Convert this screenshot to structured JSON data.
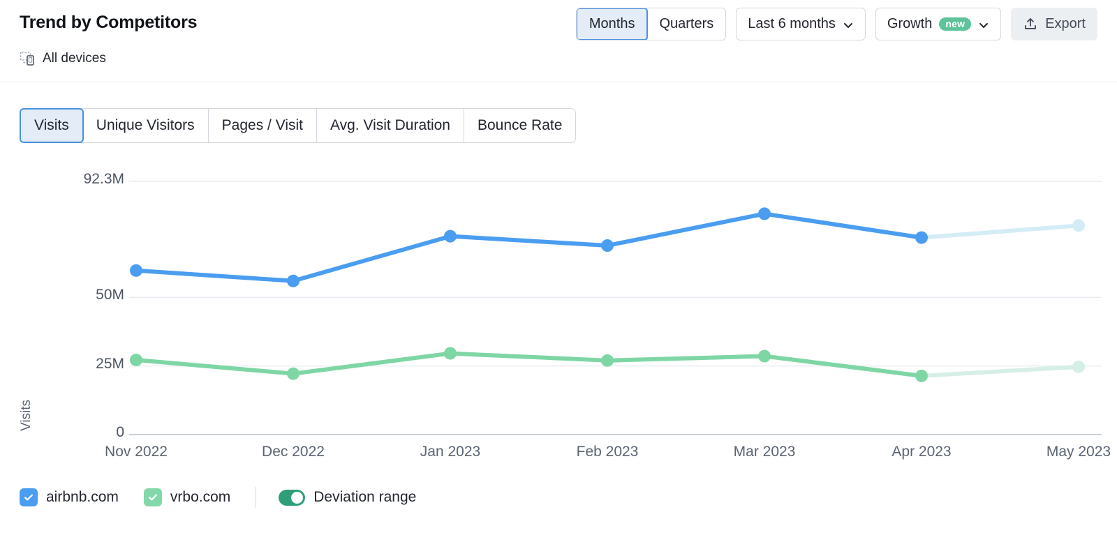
{
  "header": {
    "title": "Trend by Competitors",
    "devices_label": "All devices",
    "devices_icon": "devices-icon",
    "granularity": {
      "options": [
        "Months",
        "Quarters"
      ],
      "selected": "Months"
    },
    "period": {
      "label": "Last 6 months",
      "icon": "chevron-down-icon"
    },
    "growth": {
      "label": "Growth",
      "badge": "new",
      "icon": "chevron-down-icon"
    },
    "export": {
      "label": "Export",
      "icon": "upload-icon"
    }
  },
  "tabs": {
    "items": [
      "Visits",
      "Unique Visitors",
      "Pages / Visit",
      "Avg. Visit Duration",
      "Bounce Rate"
    ],
    "selected": "Visits"
  },
  "legend": {
    "items": [
      {
        "label": "airbnb.com",
        "color": "#4a9df0",
        "checked": true
      },
      {
        "label": "vrbo.com",
        "color": "#82d8a8",
        "checked": true
      }
    ],
    "deviation": {
      "label": "Deviation range",
      "enabled": true,
      "color": "#2e9e78"
    }
  },
  "colors": {
    "airbnb": "#4a9df0",
    "vrbo": "#7fd6a5",
    "airbnb_faded": "#d3ecf5",
    "vrbo_faded": "#d6efe6",
    "grid": "#e8ecf1",
    "axis": "#b9c0c9",
    "accent": "#4a90e2",
    "badge_green": "#5ec39a",
    "toggle_green": "#2e9e78"
  },
  "chart_data": {
    "type": "line",
    "title": "Trend by Competitors",
    "ylabel": "Visits",
    "xlabel": "",
    "categories": [
      "Nov 2022",
      "Dec 2022",
      "Jan 2023",
      "Feb 2023",
      "Mar 2023",
      "Apr 2023",
      "May 2023"
    ],
    "yticks": [
      "0",
      "25M",
      "50M",
      "92.3M"
    ],
    "ytick_values": [
      0,
      25000000,
      50000000,
      92300000
    ],
    "ylim": [
      0,
      92300000
    ],
    "grid": true,
    "legend_position": "bottom",
    "forecast_from": "Apr 2023",
    "forecast_note": "Last segment (Apr 2023 → May 2023) rendered faded as deviation range",
    "series": [
      {
        "name": "airbnb.com",
        "color": "#4a9df0",
        "values": [
          59800000,
          56000000,
          72300000,
          68900000,
          80500000,
          71800000,
          76200000
        ]
      },
      {
        "name": "vrbo.com",
        "color": "#7fd6a5",
        "values": [
          27200000,
          22200000,
          29600000,
          27000000,
          28600000,
          21400000,
          24700000
        ]
      }
    ]
  }
}
